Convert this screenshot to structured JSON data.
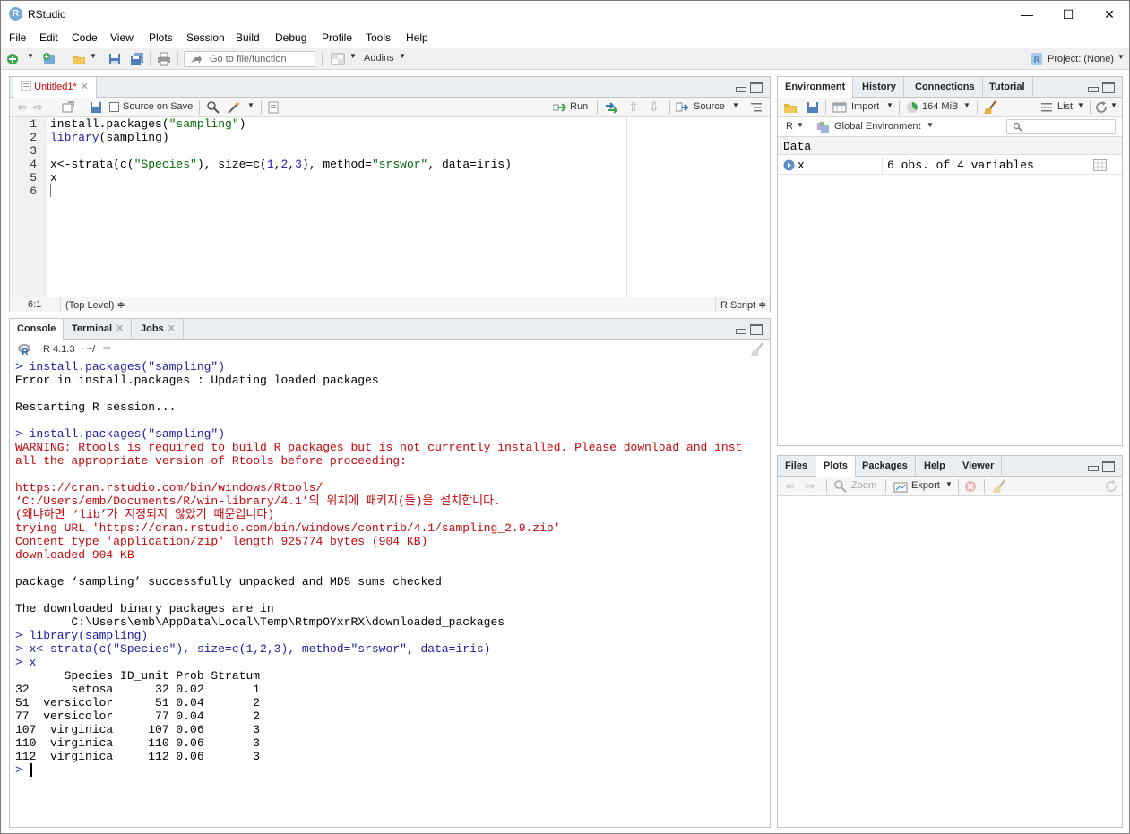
{
  "window": {
    "title": "RStudio",
    "minimize": "—",
    "maximize": "☐",
    "close": "✕"
  },
  "menu": [
    "File",
    "Edit",
    "Code",
    "View",
    "Plots",
    "Session",
    "Build",
    "Debug",
    "Profile",
    "Tools",
    "Help"
  ],
  "toolbar": {
    "goto_placeholder": "Go to file/function",
    "addins": "Addins",
    "project": "Project: (None)"
  },
  "source": {
    "tab_label": "Untitled1*",
    "source_on_save": "Source on Save",
    "run": "Run",
    "source_btn": "Source",
    "lines": [
      {
        "num": "1",
        "parts": [
          [
            "install.packages(",
            ""
          ],
          [
            "\"sampling\"",
            "str"
          ],
          [
            ")",
            ""
          ]
        ]
      },
      {
        "num": "2",
        "parts": [
          [
            "library",
            "kw"
          ],
          [
            "(sampling)",
            ""
          ]
        ]
      },
      {
        "num": "3",
        "parts": []
      },
      {
        "num": "4",
        "parts": [
          [
            "x<-strata(c(",
            ""
          ],
          [
            "\"Species\"",
            "str"
          ],
          [
            "), size=c(",
            ""
          ],
          [
            "1",
            "num"
          ],
          [
            ",",
            ""
          ],
          [
            "2",
            "num"
          ],
          [
            ",",
            ""
          ],
          [
            "3",
            "num"
          ],
          [
            "), method=",
            ""
          ],
          [
            "\"srswor\"",
            "str"
          ],
          [
            ", data=iris)",
            ""
          ]
        ]
      },
      {
        "num": "5",
        "parts": [
          [
            "x",
            ""
          ]
        ]
      },
      {
        "num": "6",
        "parts": []
      }
    ],
    "cursor_pos": "6:1",
    "scope": "(Top Level) ≑",
    "file_type": "R Script ≑"
  },
  "console": {
    "tabs": [
      "Console",
      "Terminal",
      "Jobs"
    ],
    "r_version": "R 4.1.3",
    "wd": "· ~/",
    "lines": [
      {
        "t": "> install.packages(\"sampling\")",
        "c": "cmd"
      },
      {
        "t": "Error in install.packages : Updating loaded packages",
        "c": "out"
      },
      {
        "t": "",
        "c": "out"
      },
      {
        "t": "Restarting R session...",
        "c": "out"
      },
      {
        "t": "",
        "c": "out"
      },
      {
        "t": "> install.packages(\"sampling\")",
        "c": "cmd"
      },
      {
        "t": "WARNING: Rtools is required to build R packages but is not currently installed. Please download and inst",
        "c": "err"
      },
      {
        "t": "all the appropriate version of Rtools before proceeding:",
        "c": "err"
      },
      {
        "t": "",
        "c": "out"
      },
      {
        "t": "https://cran.rstudio.com/bin/windows/Rtools/",
        "c": "err"
      },
      {
        "t": "‘C:/Users/emb/Documents/R/win-library/4.1’의 위치에 패키지(들)을 설치합니다.",
        "c": "err"
      },
      {
        "t": "(왜냐하면 ‘lib’가 지정되지 않았기 때문입니다)",
        "c": "err"
      },
      {
        "t": "trying URL 'https://cran.rstudio.com/bin/windows/contrib/4.1/sampling_2.9.zip'",
        "c": "err"
      },
      {
        "t": "Content type 'application/zip' length 925774 bytes (904 KB)",
        "c": "err"
      },
      {
        "t": "downloaded 904 KB",
        "c": "err"
      },
      {
        "t": "",
        "c": "out"
      },
      {
        "t": "package ‘sampling’ successfully unpacked and MD5 sums checked",
        "c": "out"
      },
      {
        "t": "",
        "c": "out"
      },
      {
        "t": "The downloaded binary packages are in",
        "c": "out"
      },
      {
        "t": "        C:\\Users\\emb\\AppData\\Local\\Temp\\RtmpOYxrRX\\downloaded_packages",
        "c": "out"
      },
      {
        "t": "> library(sampling)",
        "c": "cmd"
      },
      {
        "t": "> x<-strata(c(\"Species\"), size=c(1,2,3), method=\"srswor\", data=iris)",
        "c": "cmd"
      },
      {
        "t": "> x",
        "c": "cmd"
      },
      {
        "t": "       Species ID_unit Prob Stratum",
        "c": "out"
      },
      {
        "t": "32      setosa      32 0.02       1",
        "c": "out"
      },
      {
        "t": "51  versicolor      51 0.04       2",
        "c": "out"
      },
      {
        "t": "77  versicolor      77 0.04       2",
        "c": "out"
      },
      {
        "t": "107  virginica     107 0.06       3",
        "c": "out"
      },
      {
        "t": "110  virginica     110 0.06       3",
        "c": "out"
      },
      {
        "t": "112  virginica     112 0.06       3",
        "c": "out"
      },
      {
        "t": "> ",
        "c": "cmd"
      }
    ]
  },
  "env": {
    "tabs": [
      "Environment",
      "History",
      "Connections",
      "Tutorial"
    ],
    "import": "Import",
    "memory": "164 MiB",
    "list": "List",
    "lang": "R",
    "scope": "Global Environment",
    "section": "Data",
    "rows": [
      {
        "name": "x",
        "value": "6 obs. of 4 variables"
      }
    ]
  },
  "files": {
    "tabs": [
      "Files",
      "Plots",
      "Packages",
      "Help",
      "Viewer"
    ],
    "zoom": "Zoom",
    "export": "Export"
  }
}
